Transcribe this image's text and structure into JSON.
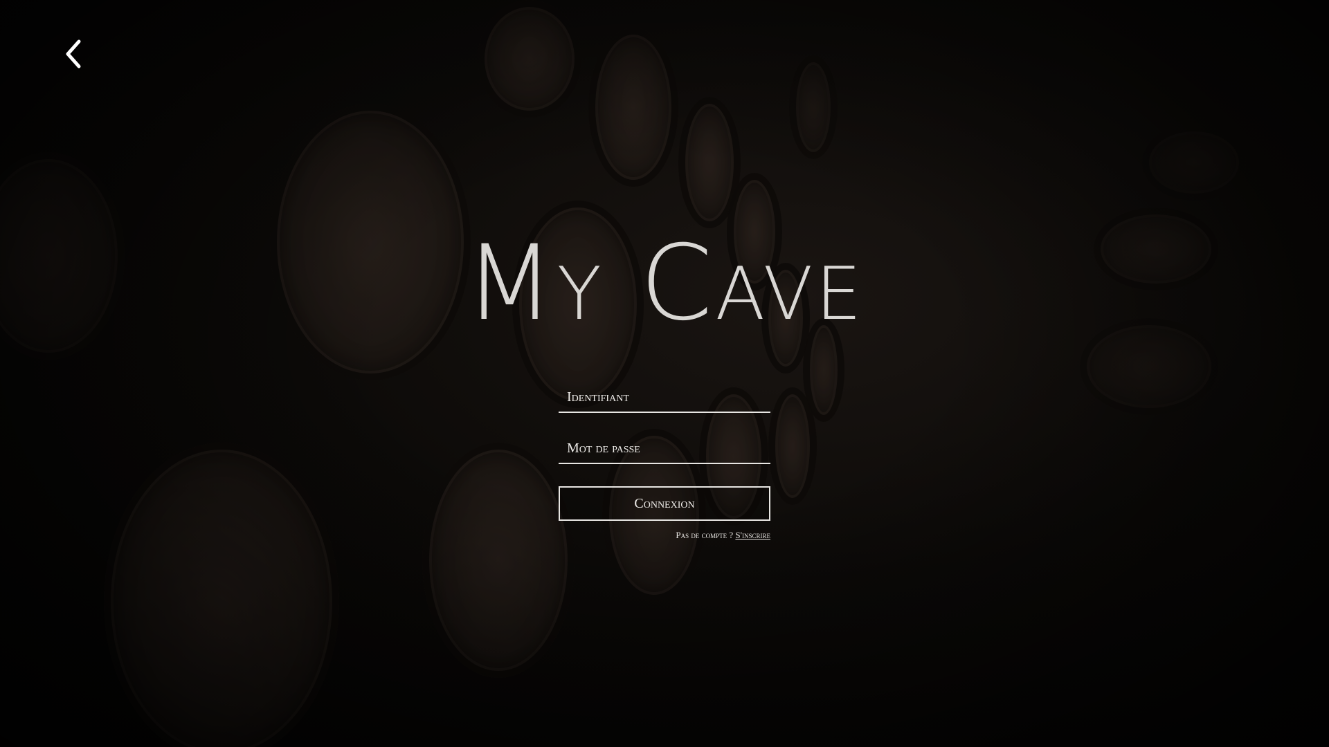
{
  "app": {
    "title": "My Cave"
  },
  "nav": {
    "back_icon": "chevron-left-icon"
  },
  "login": {
    "username_placeholder": "Identifiant",
    "password_placeholder": "Mot de passe",
    "submit_label": "Connexion",
    "no_account_text": "Pas de compte ?",
    "signup_link": "S'inscrire"
  },
  "colors": {
    "background": "#050403",
    "text": "#e8e6e3"
  }
}
